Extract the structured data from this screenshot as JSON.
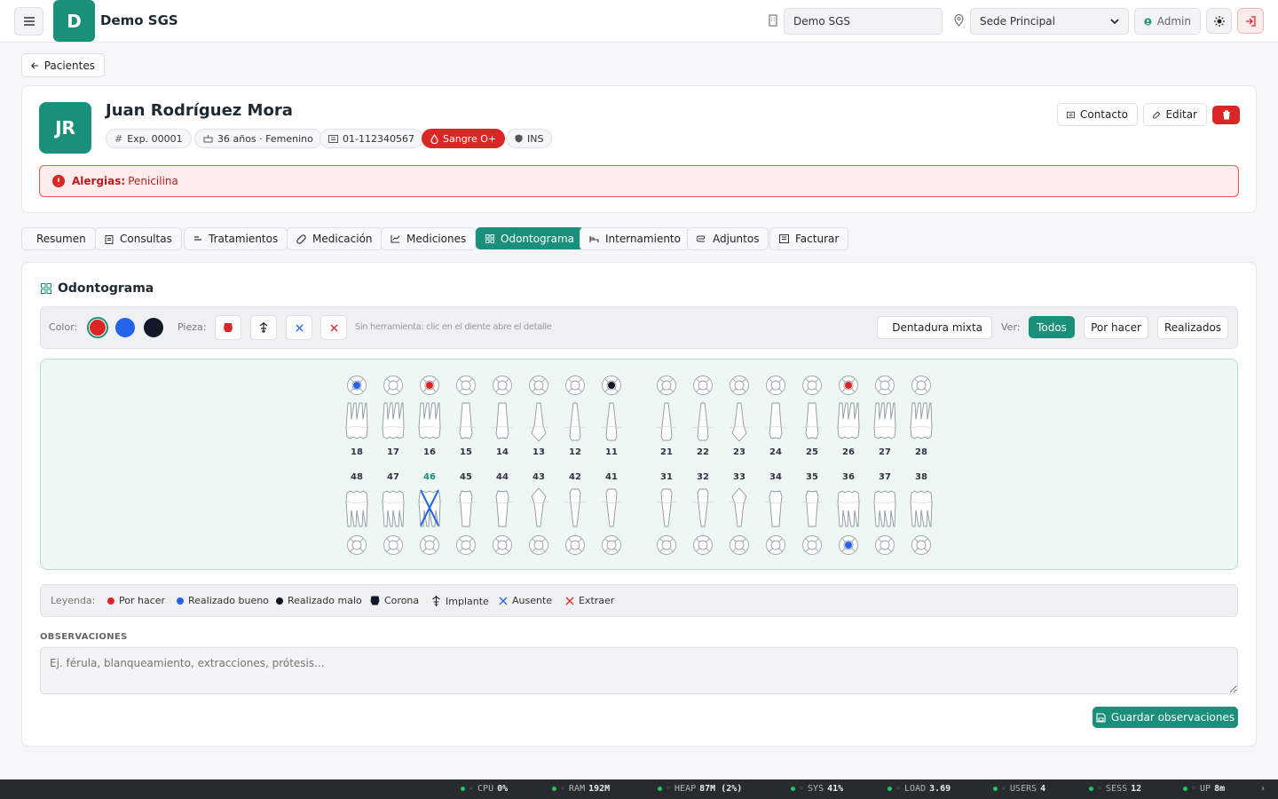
{
  "header": {
    "menu_icon": "hamburger-icon",
    "logo_letter": "D",
    "brand": "Demo SGS",
    "org_field": "Demo SGS",
    "site_select": "Sede Principal",
    "user_label": "Admin"
  },
  "back_button": "Pacientes",
  "patient": {
    "initials": "JR",
    "name": "Juan Rodríguez Mora",
    "exp": "Exp. 00001",
    "age_sex": "36 años · Femenino",
    "id_number": "01-112340567",
    "blood": "Sangre O+",
    "insurance": "INS",
    "contact_btn": "Contacto",
    "edit_btn": "Editar",
    "allergy_label": "Alergias:",
    "allergy_value": "Penicilina"
  },
  "tabs": [
    "Resumen",
    "Consultas",
    "Tratamientos",
    "Medicación",
    "Mediciones",
    "Odontograma",
    "Internamiento",
    "Adjuntos",
    "Facturar"
  ],
  "odontogram": {
    "title": "Odontograma",
    "color_label": "Color:",
    "piece_label": "Pieza:",
    "hint": "Sin herramienta: clic en el diente abre el detalle",
    "mixed_btn": "Dentadura mixta",
    "view_label": "Ver:",
    "filters": [
      "Todos",
      "Por hacer",
      "Realizados"
    ],
    "colors": {
      "todo": "#dc2626",
      "done_good": "#2563eb",
      "done_bad": "#111827"
    },
    "upper": [
      "18",
      "17",
      "16",
      "15",
      "14",
      "13",
      "12",
      "11",
      "21",
      "22",
      "23",
      "24",
      "25",
      "26",
      "27",
      "28"
    ],
    "lower": [
      "48",
      "47",
      "46",
      "45",
      "44",
      "43",
      "42",
      "41",
      "31",
      "32",
      "33",
      "34",
      "35",
      "36",
      "37",
      "38"
    ],
    "marks_upper": {
      "18": "blue",
      "16": "red",
      "11": "black",
      "26": "red"
    },
    "marks_lower": {
      "36": "blue"
    },
    "absent": [
      "46"
    ],
    "legend_label": "Leyenda:",
    "legend": [
      "Por hacer",
      "Realizado bueno",
      "Realizado malo",
      "Corona",
      "Implante",
      "Ausente",
      "Extraer"
    ],
    "obs_label": "OBSERVACIONES",
    "obs_placeholder": "Ej. férula, blanqueamiento, extracciones, prótesis...",
    "save_btn": "Guardar observaciones"
  },
  "status": [
    {
      "k": "CPU",
      "v": "0%"
    },
    {
      "k": "RAM",
      "v": "192M"
    },
    {
      "k": "HEAP",
      "v": "87M (2%)"
    },
    {
      "k": "SYS",
      "v": "41%"
    },
    {
      "k": "LOAD",
      "v": "3.69"
    },
    {
      "k": "USERS",
      "v": "4"
    },
    {
      "k": "SESS",
      "v": "12"
    },
    {
      "k": "UP",
      "v": "8m"
    }
  ]
}
